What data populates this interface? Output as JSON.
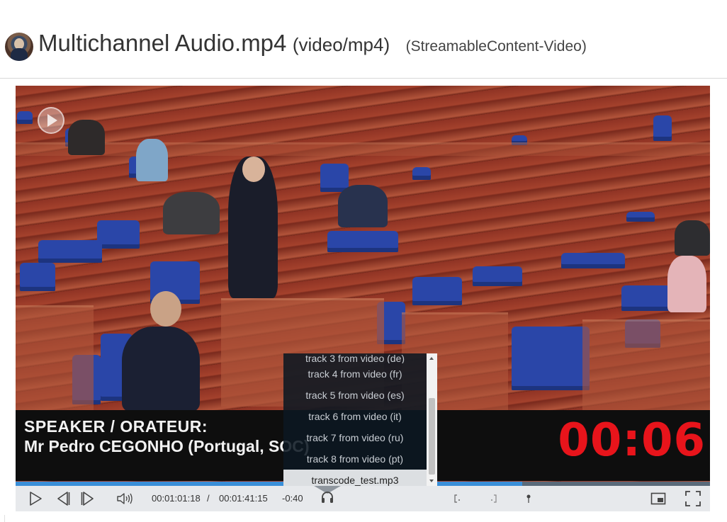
{
  "header": {
    "title": "Multichannel Audio.mp4",
    "mime": "(video/mp4)",
    "content_type": "(StreamableContent-Video)",
    "avatar_icon": "user-avatar"
  },
  "video": {
    "overlay_line1": "SPEAKER / ORATEUR:",
    "overlay_line2": "Mr Pedro CEGONHO (Portugal, SOC)",
    "timer": "00:06",
    "progress_fraction": 0.73,
    "progress_color": "#3a8fd8"
  },
  "controls": {
    "current_time": "00:01:01:18",
    "separator": "/",
    "duration": "00:01:41:15",
    "remaining": "-0:40",
    "icons": [
      "play-icon",
      "step-back-icon",
      "step-forward-icon",
      "volume-icon",
      "headphones-icon",
      "mark-in-icon",
      "mark-out-icon",
      "marker-pin-icon",
      "picture-in-picture-icon",
      "fullscreen-icon"
    ]
  },
  "track_menu": {
    "partial_label": "track 3 from video (de)",
    "items": [
      "track 4 from video (fr)",
      "track 5 from video (es)",
      "track 6 from video (it)",
      "track 7 from video (ru)",
      "track 8 from video (pt)",
      "transcode_test.mp3"
    ],
    "selected": "transcode_test.mp3"
  }
}
